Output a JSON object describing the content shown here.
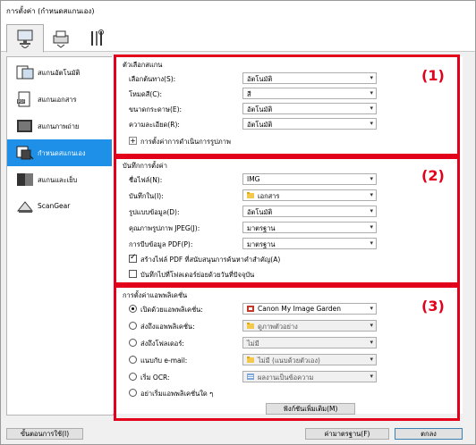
{
  "window": {
    "title": "การตั้งค่า (กำหนดสแกนเอง)"
  },
  "tabs": [
    {
      "name": "scan-tab",
      "icon": "computer-scan-icon"
    },
    {
      "name": "scanner-tab",
      "icon": "scanner-icon"
    },
    {
      "name": "general-settings-tab",
      "icon": "tools-icon"
    }
  ],
  "sidebar": {
    "items": [
      {
        "label": "สแกนอัตโนมัติ",
        "icon": "auto-scan-icon"
      },
      {
        "label": "สแกนเอกสาร",
        "icon": "document-scan-icon"
      },
      {
        "label": "สแกนภาพถ่าย",
        "icon": "photo-scan-icon"
      },
      {
        "label": "กำหนดสแกนเอง",
        "icon": "custom-scan-icon",
        "selected": true
      },
      {
        "label": "สแกนและเย็บ",
        "icon": "scan-stitch-icon"
      },
      {
        "label": "ScanGear",
        "icon": "scangear-icon"
      }
    ]
  },
  "scan_options": {
    "group_title": "ตัวเลือกสแกน",
    "number": "(1)",
    "rows": [
      {
        "label": "เลือกต้นทาง(S):",
        "value": "อัตโนมัติ"
      },
      {
        "label": "โหมดสี(C):",
        "value": "สี"
      },
      {
        "label": "ขนาดกระดาษ(E):",
        "value": "อัตโนมัติ"
      },
      {
        "label": "ความละเอียด(R):",
        "value": "อัตโนมัติ"
      }
    ],
    "image_processing": "การตั้งค่าการดำเนินการรูปภาพ"
  },
  "save_settings": {
    "group_title": "บันทึกการตั้งค่า",
    "number": "(2)",
    "rows": [
      {
        "label": "ชื่อไฟล์(N):",
        "value": "IMG"
      },
      {
        "label": "บันทึกใน(I):",
        "value": "เอกสาร",
        "icon": "folder-icon"
      },
      {
        "label": "รูปแบบข้อมูล(D):",
        "value": "อัตโนมัติ"
      },
      {
        "label": "คุณภาพรูปภาพ JPEG(J):",
        "value": "มาตรฐาน"
      },
      {
        "label": "การบีบข้อมูล PDF(P):",
        "value": "มาตรฐาน"
      }
    ],
    "checkbox1": "สร้างไฟล์ PDF ที่สนับสนุนการค้นหาคำสำคัญ(A)",
    "checkbox2": "บันทึกไปที่โฟลเดอร์ย่อยด้วยวันที่ปัจจุบัน"
  },
  "app_settings": {
    "group_title": "การตั้งค่าแอพพลิเคชั่น",
    "number": "(3)",
    "rows": [
      {
        "label": "เปิดด้วยแอพพลิเคชั่น:",
        "value": "Canon My Image Garden",
        "icon": "app-icon",
        "checked": true
      },
      {
        "label": "ส่งถึงแอพพลิเคชั่น:",
        "value": "ดูภาพตัวอย่าง",
        "icon": "folder-icon",
        "checked": false
      },
      {
        "label": "ส่งถึงโฟลเดอร์:",
        "value": "ไม่มี",
        "checked": false
      },
      {
        "label": "แนบกับ e-mail:",
        "value": "ไม่มี (แนบด้วยตัวเอง)",
        "icon": "folder-icon",
        "checked": false
      },
      {
        "label": "เริ่ม OCR:",
        "value": "ผลงานเป็นข้อความ",
        "icon": "ocr-icon",
        "checked": false
      }
    ],
    "no_app": "อย่าเริ่มแอพพลิเคชั่นใด ๆ",
    "more_functions": "ฟังก์ชันเพิ่มเติม(M)"
  },
  "footer": {
    "instructions": "ขั้นตอนการใช้(I)",
    "defaults": "ค่ามาตรฐาน(F)",
    "ok": "ตกลง"
  },
  "colors": {
    "accent": "#1e90e8",
    "highlight": "#e2001a"
  }
}
